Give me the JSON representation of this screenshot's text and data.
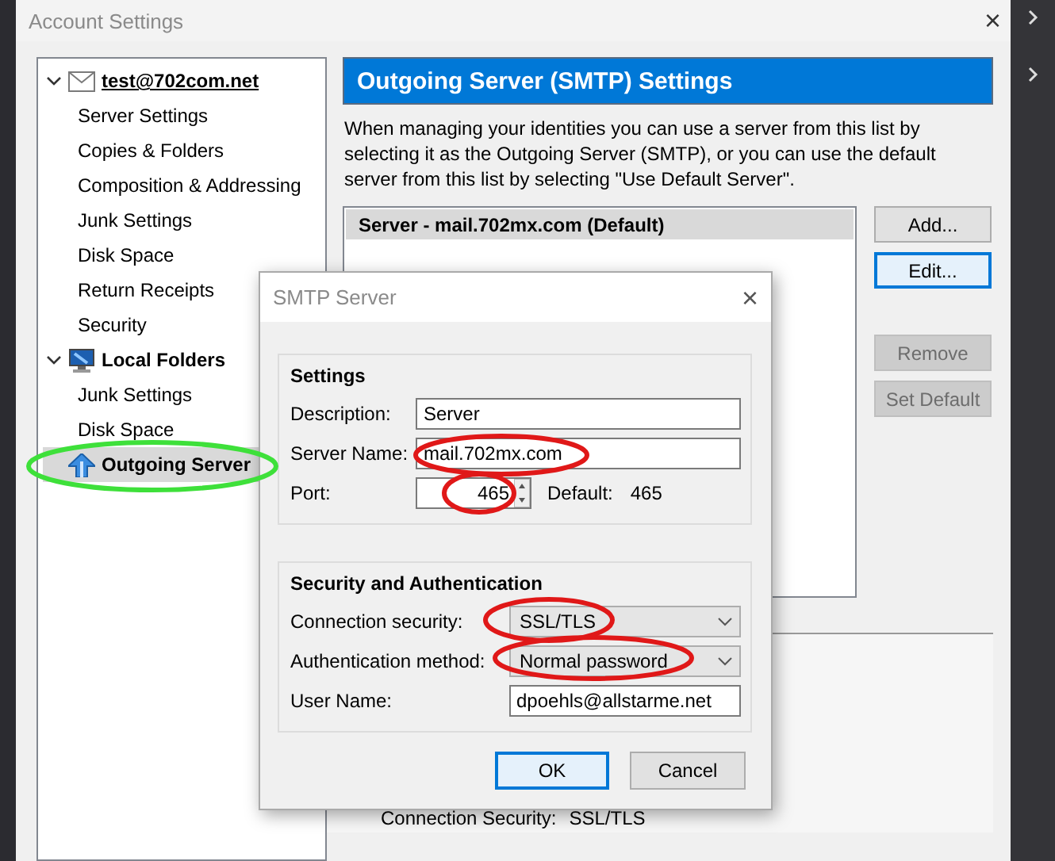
{
  "window": {
    "title": "Account Settings",
    "close": "×"
  },
  "tree": [
    {
      "label": "test@702com.net",
      "kind": "account",
      "expanded": true,
      "selected": false,
      "children": [
        {
          "label": "Server Settings",
          "selected": false
        },
        {
          "label": "Copies & Folders",
          "selected": false
        },
        {
          "label": "Composition & Addressing",
          "selected": false
        },
        {
          "label": "Junk Settings",
          "selected": false
        },
        {
          "label": "Disk Space",
          "selected": false
        },
        {
          "label": "Return Receipts",
          "selected": false
        },
        {
          "label": "Security",
          "selected": false
        }
      ]
    },
    {
      "label": "Local Folders",
      "kind": "local",
      "expanded": true,
      "selected": false,
      "children": [
        {
          "label": "Junk Settings",
          "selected": false
        },
        {
          "label": "Disk Space",
          "selected": false
        }
      ]
    },
    {
      "label": "Outgoing Server",
      "kind": "smtp",
      "selected": true
    }
  ],
  "panel": {
    "title": "Outgoing Server (SMTP) Settings",
    "description": "When managing your identities you can use a server from this list by selecting it as the Outgoing Server (SMTP), or you can use the default server from this list by selecting \"Use Default Server\".",
    "servers": [
      {
        "label": "Server - mail.702mx.com (Default)",
        "selected": true
      }
    ],
    "buttons": [
      {
        "label": "Add...",
        "disabled": false,
        "focused": false
      },
      {
        "label": "Edit...",
        "disabled": false,
        "focused": true
      },
      {
        "label": "Remove",
        "disabled": true,
        "focused": false
      },
      {
        "label": "Set Default",
        "disabled": true,
        "focused": false
      }
    ],
    "details": [
      {
        "label": "Connection Security:",
        "value": "SSL/TLS"
      }
    ]
  },
  "dialog": {
    "title": "SMTP Server",
    "close": "×",
    "settings": {
      "heading": "Settings",
      "fields": [
        {
          "label": "Description:",
          "value": "Server"
        },
        {
          "label": "Server Name:",
          "value": "mail.702mx.com"
        }
      ],
      "port": {
        "label": "Port:",
        "value": "465",
        "default_label": "Default:",
        "default_value": "465"
      }
    },
    "security": {
      "heading": "Security and Authentication",
      "fields": [
        {
          "kind": "dropdown",
          "label": "Connection security:",
          "value": "SSL/TLS"
        },
        {
          "kind": "dropdown",
          "label": "Authentication method:",
          "value": "Normal password"
        },
        {
          "kind": "text",
          "label": "User Name:",
          "value": "dpoehls@allstarme.net"
        }
      ]
    },
    "buttons": [
      {
        "label": "OK",
        "default": true
      },
      {
        "label": "Cancel",
        "default": false
      }
    ]
  }
}
